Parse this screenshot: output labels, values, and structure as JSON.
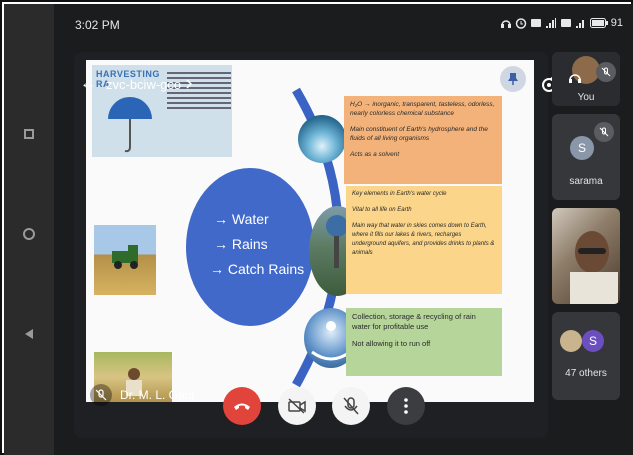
{
  "status_bar": {
    "time": "3:02 PM",
    "battery": "91"
  },
  "meeting": {
    "code": "zvc-bciw-gco",
    "presenter": "Dr. M. L. Gaur"
  },
  "slide": {
    "harvest_title_1": "HARVESTING",
    "harvest_title_2": "RA",
    "circle_items": [
      "→ Water",
      "→ Rains",
      "→ Catch Rains"
    ],
    "box_orange": {
      "line1": "H₂O → inorganic, transparent, tasteless, odorless, nearly colorless chemical substance",
      "line2": "Main constituent of Earth's hydrosphere and the fluids of all living organisms",
      "line3": "Acts as a solvent"
    },
    "box_yellow": {
      "line1": "Key elements in Earth's water cycle",
      "line2": "Vital to all life on Earth",
      "line3": "Main way that water in skies comes down to Earth, where it fills our lakes & rivers, recharges underground aquifers, and provides drinks to plants & animals"
    },
    "box_green": {
      "line1": "Collection, storage & recycling of rain water for profitable use",
      "line2": "Not allowing it to run off"
    }
  },
  "participants": {
    "you_label": "You",
    "sarama_label": "sarama",
    "sarama_initial": "S",
    "others_initial": "S",
    "others_label": "47 others"
  },
  "colors": {
    "hangup": "#e0443a",
    "circle": "#4169c9"
  }
}
